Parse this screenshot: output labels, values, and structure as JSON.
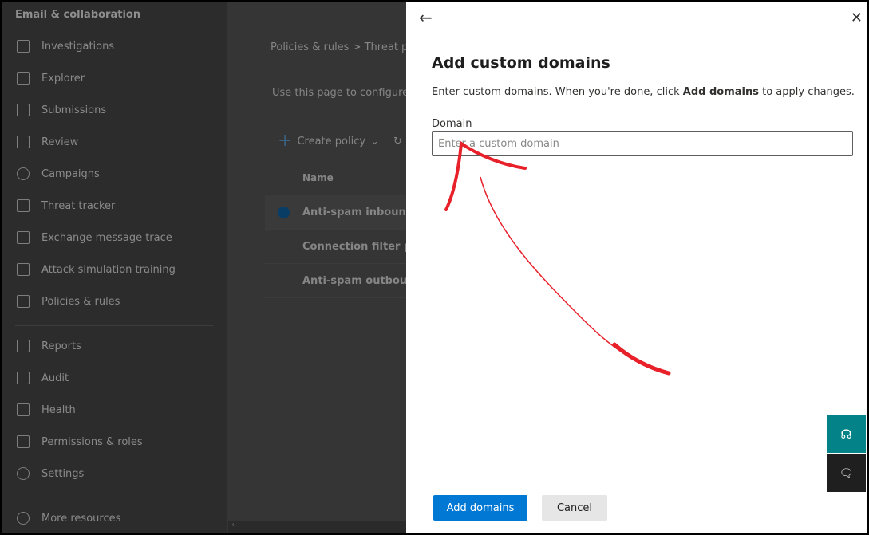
{
  "sidebar": {
    "header": "Email & collaboration",
    "items": [
      {
        "label": "Investigations",
        "icon": "investigations-icon"
      },
      {
        "label": "Explorer",
        "icon": "explorer-icon"
      },
      {
        "label": "Submissions",
        "icon": "submissions-icon"
      },
      {
        "label": "Review",
        "icon": "review-icon"
      },
      {
        "label": "Campaigns",
        "icon": "campaigns-icon"
      },
      {
        "label": "Threat tracker",
        "icon": "chart-icon"
      },
      {
        "label": "Exchange message trace",
        "icon": "exchange-icon"
      },
      {
        "label": "Attack simulation training",
        "icon": "simulation-icon"
      },
      {
        "label": "Policies & rules",
        "icon": "sliders-icon"
      },
      {
        "label": "Reports",
        "icon": "chart-icon"
      },
      {
        "label": "Audit",
        "icon": "audit-icon"
      },
      {
        "label": "Health",
        "icon": "heart-icon"
      },
      {
        "label": "Permissions & roles",
        "icon": "key-icon"
      },
      {
        "label": "Settings",
        "icon": "gear-icon"
      },
      {
        "label": "More resources",
        "icon": "info-icon"
      }
    ]
  },
  "content": {
    "breadcrumb": "Policies & rules  >  Threat p",
    "description": "Use this page to configure p filtering, spam filtering, and",
    "create_policy": "Create policy",
    "column_name": "Name",
    "rows": [
      "Anti-spam inbound p",
      "Connection filter pol",
      "Anti-spam outbound"
    ]
  },
  "panel": {
    "title": "Add custom domains",
    "intro_pre": "Enter custom domains. When you're done, click ",
    "intro_bold": "Add domains",
    "intro_post": " to apply changes.",
    "domain_label": "Domain",
    "domain_placeholder": "Enter a custom domain",
    "domain_value": "",
    "add_button": "Add domains",
    "cancel_button": "Cancel"
  },
  "colors": {
    "primary": "#0078d4",
    "help": "#038387",
    "annotation": "#e8202a"
  }
}
